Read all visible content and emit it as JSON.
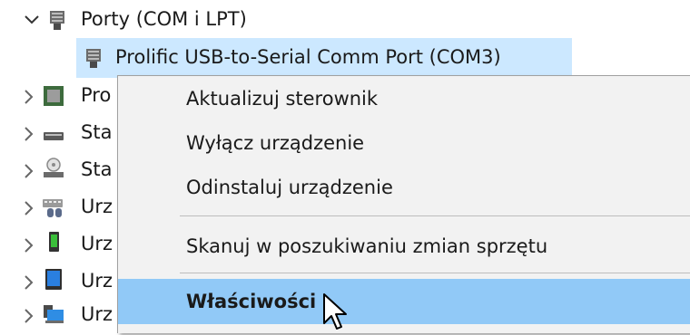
{
  "tree": {
    "ports_label": "Porty (COM i LPT)",
    "child_label": "Prolific USB-to-Serial Comm Port (COM3)",
    "items": [
      {
        "label": "Pro",
        "icon": "processor-icon"
      },
      {
        "label": "Sta",
        "icon": "drive-icon"
      },
      {
        "label": "Sta",
        "icon": "storage-icon"
      },
      {
        "label": "Urz",
        "icon": "hid-devices-icon"
      },
      {
        "label": "Urz",
        "icon": "mobile-device-icon"
      },
      {
        "label": "Urz",
        "icon": "tablet-icon"
      },
      {
        "label": "Urz",
        "icon": "network-adapter-icon"
      }
    ]
  },
  "context_menu": {
    "update": "Aktualizuj sterownik",
    "disable": "Wyłącz urządzenie",
    "uninstall": "Odinstaluj urządzenie",
    "scan": "Skanuj w poszukiwaniu zmian sprzętu",
    "properties": "Właściwości"
  },
  "colors": {
    "selection": "#cce8ff",
    "menu_highlight": "#91c9f7",
    "menu_background": "#f2f2f2"
  }
}
